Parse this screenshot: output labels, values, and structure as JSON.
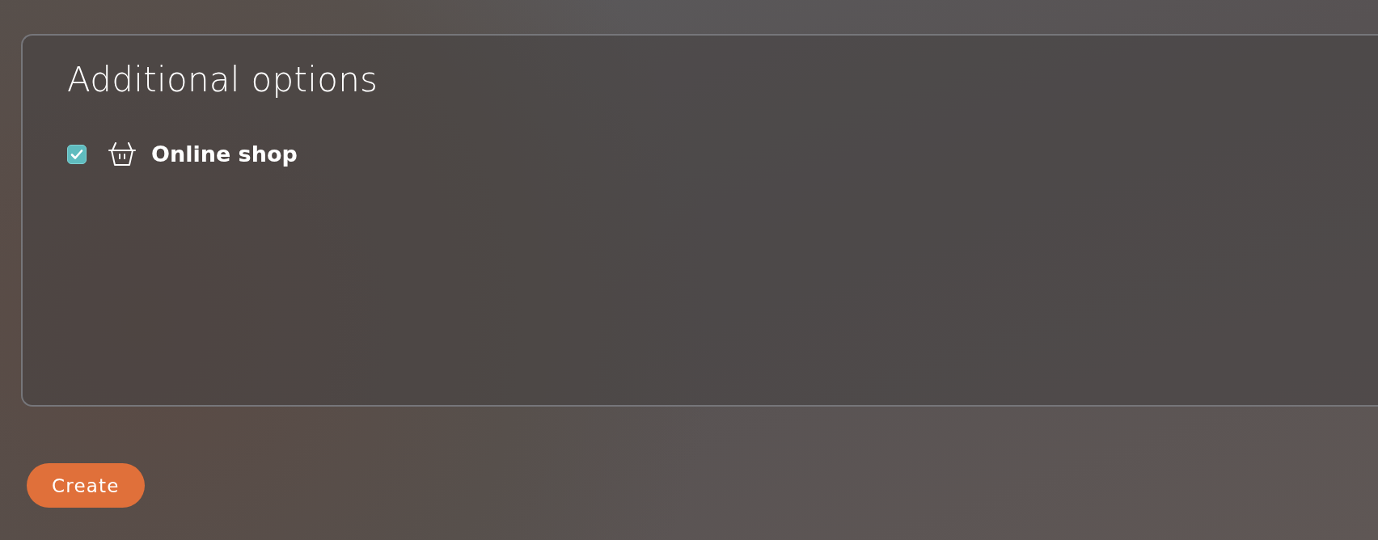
{
  "section": {
    "title": "Additional options",
    "options": [
      {
        "label": "Online shop",
        "checked": true
      }
    ]
  },
  "buttons": [
    {
      "label": "Create"
    }
  ]
}
